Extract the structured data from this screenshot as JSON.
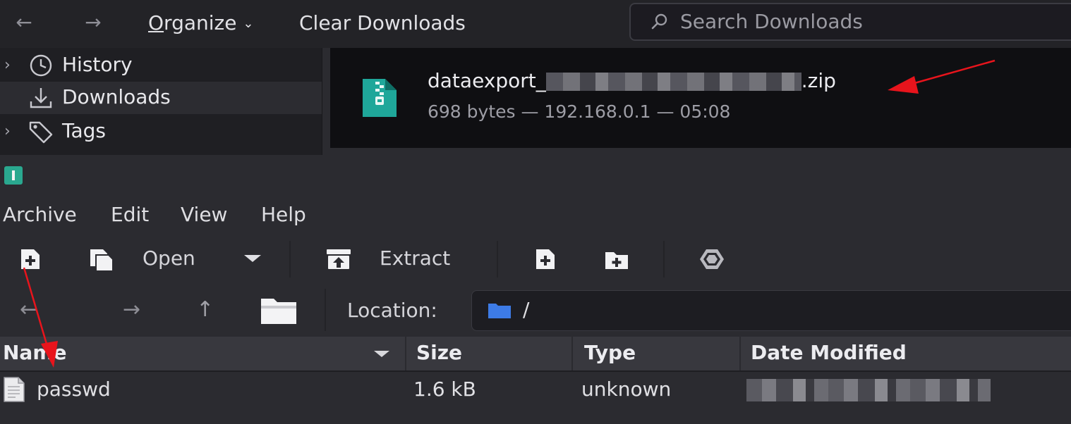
{
  "downloads_window": {
    "toolbar": {
      "back_icon": "arrow-left-icon",
      "forward_icon": "arrow-right-icon",
      "organize_first": "O",
      "organize_rest": "rganize",
      "clear_downloads": "Clear Downloads",
      "search_placeholder": "Search Downloads"
    },
    "sidebar": {
      "items": [
        {
          "label": "History",
          "icon": "clock-icon",
          "expandable": true
        },
        {
          "label": "Downloads",
          "icon": "download-icon",
          "selected": true
        },
        {
          "label": "Tags",
          "icon": "tag-icon",
          "expandable": true
        }
      ]
    },
    "download_item": {
      "icon": "zip-file-icon",
      "filename_prefix": "dataexport_",
      "filename_suffix": ".zip",
      "meta": "698 bytes — 192.168.0.1 — 05:08"
    }
  },
  "archive_manager": {
    "menu": [
      "Archive",
      "Edit",
      "View",
      "Help"
    ],
    "toolbar": {
      "open_label": "Open",
      "extract_label": "Extract"
    },
    "location": {
      "label": "Location:",
      "path": "/"
    },
    "columns": [
      "Name",
      "Size",
      "Type",
      "Date Modified"
    ],
    "files": [
      {
        "name": "passwd",
        "size": "1.6 kB",
        "type": "unknown"
      }
    ]
  },
  "annotations": {
    "arrow_color": "#e8141c"
  },
  "colors": {
    "accent_teal": "#2aa88f",
    "folder_blue": "#3d7be6"
  }
}
